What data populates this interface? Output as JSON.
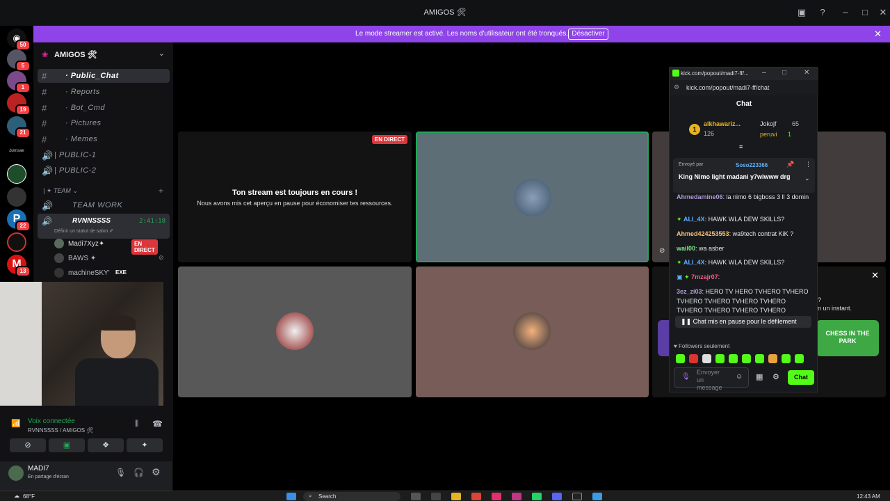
{
  "window": {
    "title": "AMIGOS 🛠"
  },
  "banner": {
    "text": "Le mode streamer est activé. Les noms d'utilisateur ont été tronqués.",
    "button": "Désactiver"
  },
  "servers": [
    {
      "badge": "50"
    },
    {
      "badge": "5"
    },
    {
      "badge": "1"
    },
    {
      "badge": "19"
    },
    {
      "badge": "21"
    },
    {
      "badge": ""
    },
    {
      "badge": ""
    },
    {
      "badge": ""
    },
    {
      "badge": "22"
    },
    {
      "badge": ""
    },
    {
      "badge": "13"
    }
  ],
  "server_label": "bumsae",
  "guild": {
    "name": "AMIGOS 🛠"
  },
  "channels": [
    {
      "label": "· Public_Chat"
    },
    {
      "label": "· Reports"
    },
    {
      "label": "· Bot_Cmd"
    },
    {
      "label": "· Pictures"
    },
    {
      "label": "· Memes"
    },
    {
      "label": "| PUBLIC-1"
    },
    {
      "label": "| PUBLIC-2"
    }
  ],
  "category": {
    "label": "| ✦ TEAM ⌄",
    "add": "+"
  },
  "voice": {
    "team_work": "TEAM WORK",
    "rvn": "RVNNSSSS",
    "rvn_time": "2:41:18",
    "rvn_status": "Définir un statut de salon ✐",
    "users": [
      {
        "name": "Madi7Xyz✦",
        "tag": "EN DIRECT"
      },
      {
        "name": "BAWS ✦",
        "tag": ""
      },
      {
        "name": "machineSKY'",
        "tag": "EXE"
      }
    ]
  },
  "voice_panel": {
    "status": "Voix connectée",
    "sub": "RVNNSSSS / AMIGOS 🛠"
  },
  "user_panel": {
    "name": "MADI7",
    "status": "En partage d'écran"
  },
  "stage": {
    "live_badge": "EN DIRECT",
    "paused_title": "Ton stream est toujours en cours !",
    "paused_sub": "Nous avons mis cet aperçu en pause pour économiser tes ressources."
  },
  "side_popup": {
    "text1": "?",
    "text2": "n un instant.",
    "game": "CHESS IN THE PARK"
  },
  "kick": {
    "tab_title": "kick.com/popout/madi7-ff/...",
    "url": "kick.com/popout/madi7-ff/chat",
    "header": "Chat",
    "top_gifter": {
      "rank": "1",
      "name": "alkhawariz...",
      "count": "126"
    },
    "gifter2": {
      "name": "Jokojf",
      "count": "65"
    },
    "gifter3": {
      "name": "peruvi",
      "count": "1"
    },
    "pinned": {
      "by_label": "Envoyé par",
      "by_user": "Soso223366",
      "text": "King Nimo light madani y7wiwww drg"
    },
    "messages": [
      {
        "user": "Ahmedamine06",
        "text": ": la nimo 6 bigboss 3 ll 3 domin",
        "color": "#b19cd9"
      },
      {
        "user": "ALI_4X",
        "text": ": HAWK WLA DEW SKILLS?",
        "color": "#5fb0ff"
      },
      {
        "user": "Ahmed424253553",
        "text": ": wa9tech contrat KiK ?",
        "color": "#f6c177"
      },
      {
        "user": "wail00",
        "text": ": wa asber",
        "color": "#7ee787"
      },
      {
        "user": "ALI_4X",
        "text": ": HAWK WLA DEW SKILLS?",
        "color": "#5fb0ff"
      },
      {
        "user": "7mzajr07",
        "text": ":",
        "color": "#ff5c8a"
      },
      {
        "user": "3ez_zi03",
        "text": ": HERO TV HERO TVHERO TVHERO TVHERO TVHERO TVHERO TVHERO TVHERO TVHERO TVHERO TVHERO TVHERO TVHERO TV",
        "color": "#b19cd9"
      }
    ],
    "paused_notice": "Chat mis en pause pour le défilement",
    "followers_only": "Followers seulement",
    "input_placeholder": "Envoyer un message",
    "send_button": "Chat"
  },
  "taskbar": {
    "weather": "68°F",
    "search": "Search",
    "time": "12:43 AM"
  }
}
